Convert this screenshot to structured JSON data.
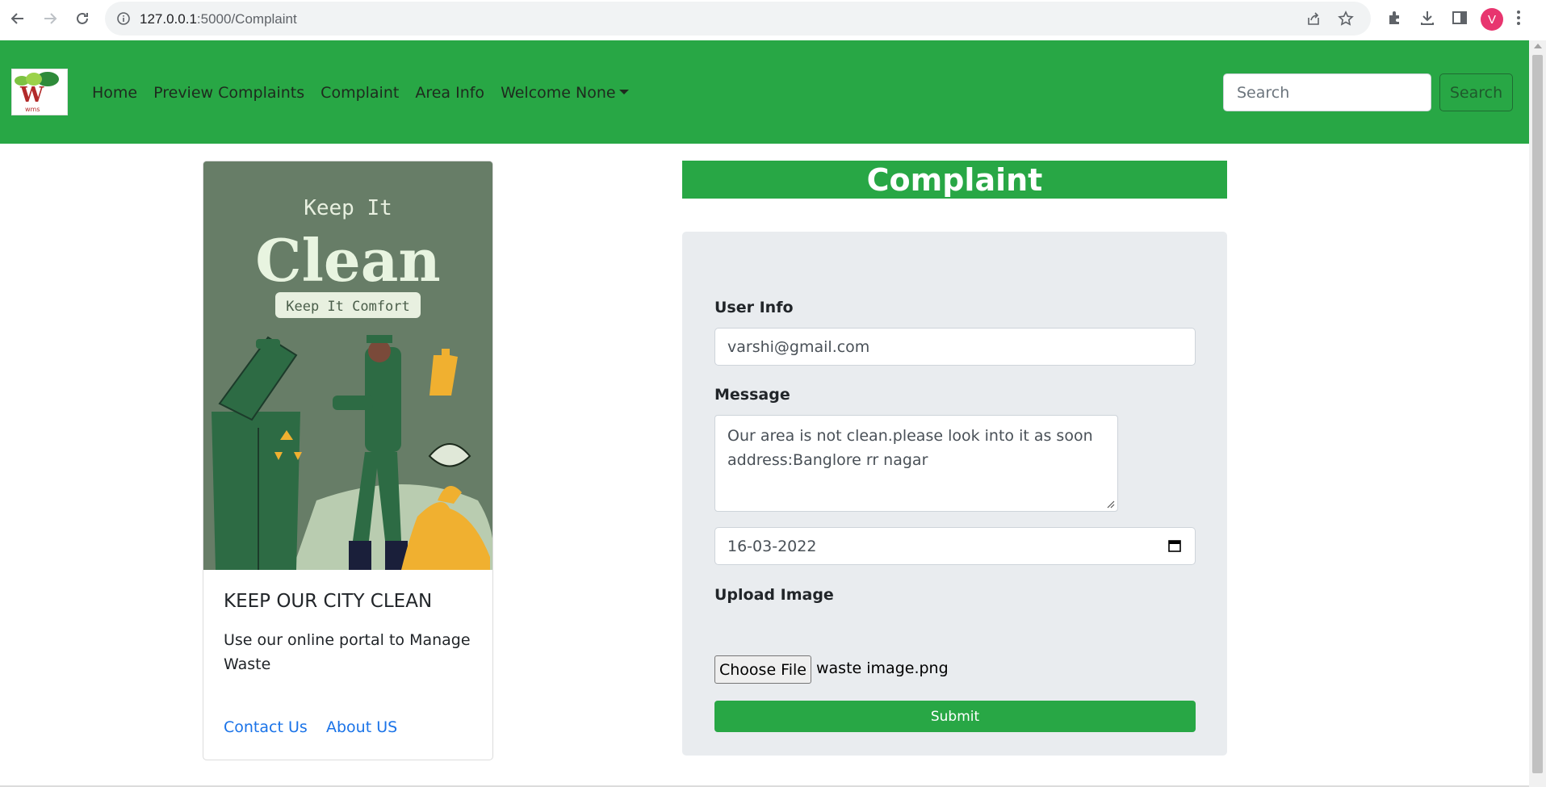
{
  "browser": {
    "url_host": "127.0.0.1",
    "url_path": ":5000/Complaint",
    "profile_initial": "V"
  },
  "navbar": {
    "brand": "wms",
    "links": [
      "Home",
      "Preview Complaints",
      "Complaint",
      "Area Info",
      "Welcome None"
    ],
    "search_placeholder": "Search",
    "search_button": "Search",
    "bg_color": "#28a745"
  },
  "card": {
    "poster": {
      "line1": "Keep It",
      "line2": "Clean",
      "line3": "Keep It Comfort"
    },
    "title": "KEEP OUR CITY CLEAN",
    "text": "Use our online portal to Manage Waste",
    "links": [
      "Contact Us",
      "About US"
    ]
  },
  "complaint": {
    "heading": "Complaint",
    "user_info_label": "User Info",
    "user_info_value": "varshi@gmail.com",
    "message_label": "Message",
    "message_line1": "Our area is not clean.please look into it as soon",
    "message_line2": "address:Banglore rr nagar",
    "date_value": "16-03-2022",
    "upload_label": "Upload Image",
    "choose_file": "Choose File",
    "file_name": "waste image.png",
    "submit": "Submit"
  }
}
